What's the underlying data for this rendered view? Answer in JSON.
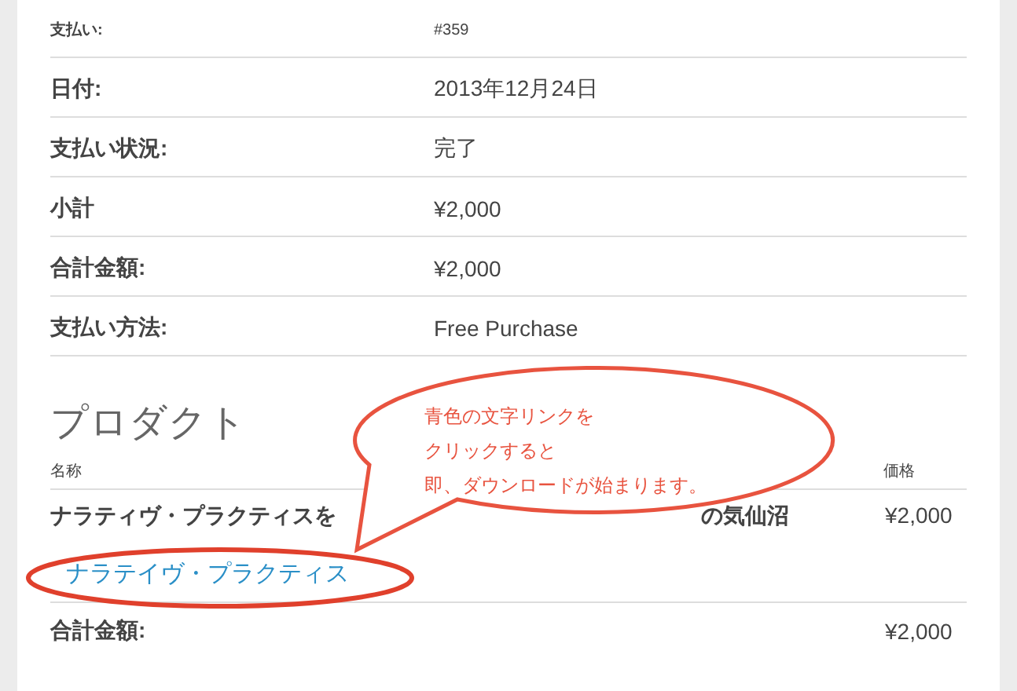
{
  "details": [
    {
      "label": "支払い:",
      "value": "#359",
      "kind": "small"
    },
    {
      "label": "日付:",
      "value": "2013年12月24日",
      "kind": "normal"
    },
    {
      "label": "支払い状況:",
      "value": "完了",
      "kind": "normal"
    },
    {
      "label": "小計",
      "value": "¥2,000",
      "kind": "normal"
    },
    {
      "label": "合計金額:",
      "value": "¥2,000",
      "kind": "normal"
    },
    {
      "label": "支払い方法:",
      "value": "Free Purchase",
      "kind": "normal"
    }
  ],
  "products": {
    "heading": "プロダクト",
    "columns": [
      "名称",
      "価格"
    ],
    "rows": [
      {
        "name_parts": [
          "ナラティヴ・プラクティスを",
          "の気仙沼"
        ],
        "link": "ナラテイヴ・プラクティス",
        "price": "¥2,000"
      }
    ],
    "total": {
      "label": "合計金額:",
      "value": "¥2,000"
    }
  },
  "callout": {
    "lines": [
      "青色の文字リンクを",
      "クリックすると",
      "即、ダウンロードが始まります。"
    ]
  }
}
